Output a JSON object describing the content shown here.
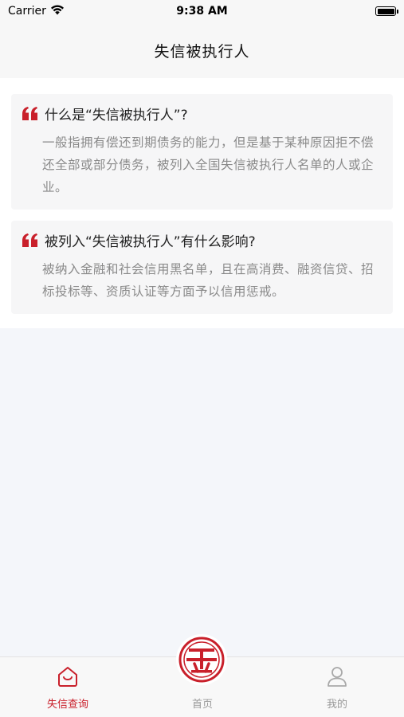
{
  "status_bar": {
    "carrier": "Carrier",
    "time": "9:38 AM",
    "icons": [
      "wifi-icon",
      "battery-icon"
    ]
  },
  "nav": {
    "title": "失信被执行人"
  },
  "cards": [
    {
      "icon": "quote-icon",
      "title": "什么是“失信被执行人”?",
      "body": "一般指拥有偿还到期债务的能力，但是基于某种原因拒不偿还全部或部分债务，被列入全国失信被执行人名单的人或企业。"
    },
    {
      "icon": "quote-icon",
      "title": "被列入“失信被执行人”有什么影响?",
      "body": "被纳入金融和社会信用黑名单，且在高消费、融资信贷、招标投标等、资质认证等方面予以信用惩戒。"
    }
  ],
  "tabs": [
    {
      "label": "失信查询",
      "icon": "home-icon",
      "active": true
    },
    {
      "label": "首页",
      "icon": "logo-icon",
      "active": false
    },
    {
      "label": "我的",
      "icon": "user-icon",
      "active": false
    }
  ],
  "colors": {
    "accent": "#c9202b",
    "inactive": "#999999",
    "card_bg": "#f6f6f7"
  }
}
